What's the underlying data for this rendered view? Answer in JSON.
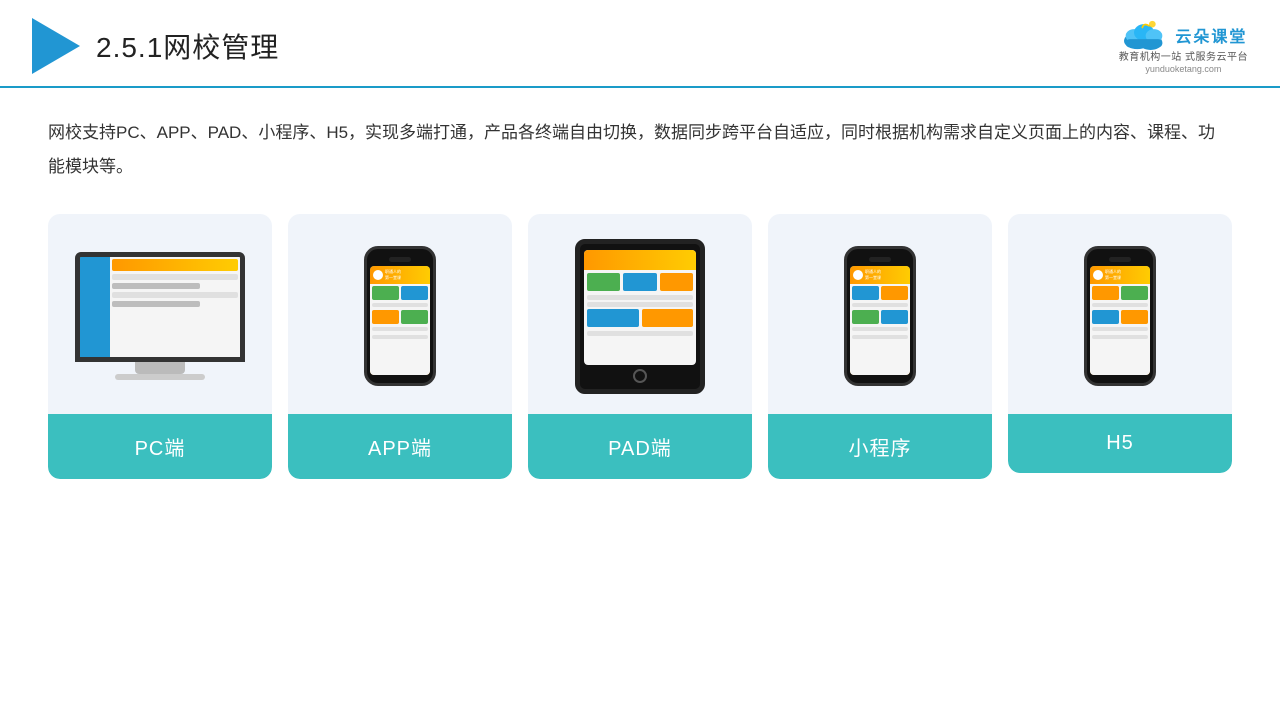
{
  "header": {
    "section_number": "2.5.1",
    "title": "网校管理",
    "logo_main": "云朵课堂",
    "logo_url": "yunduoketang.com",
    "logo_tagline": "教育机构一站\n式服务云平台"
  },
  "description": "网校支持PC、APP、PAD、小程序、H5，实现多端打通，产品各终端自由切换，数据同步跨平台自适应，同时根据机构需求自定义页面上的内容、课程、功能模块等。",
  "cards": [
    {
      "id": "pc",
      "label": "PC端",
      "device": "desktop"
    },
    {
      "id": "app",
      "label": "APP端",
      "device": "phone"
    },
    {
      "id": "pad",
      "label": "PAD端",
      "device": "tablet"
    },
    {
      "id": "miniprogram",
      "label": "小程序",
      "device": "phone"
    },
    {
      "id": "h5",
      "label": "H5",
      "device": "phone"
    }
  ],
  "colors": {
    "accent": "#2196d3",
    "card_label_bg": "#3bbfbf",
    "header_border": "#1a9bc8"
  }
}
